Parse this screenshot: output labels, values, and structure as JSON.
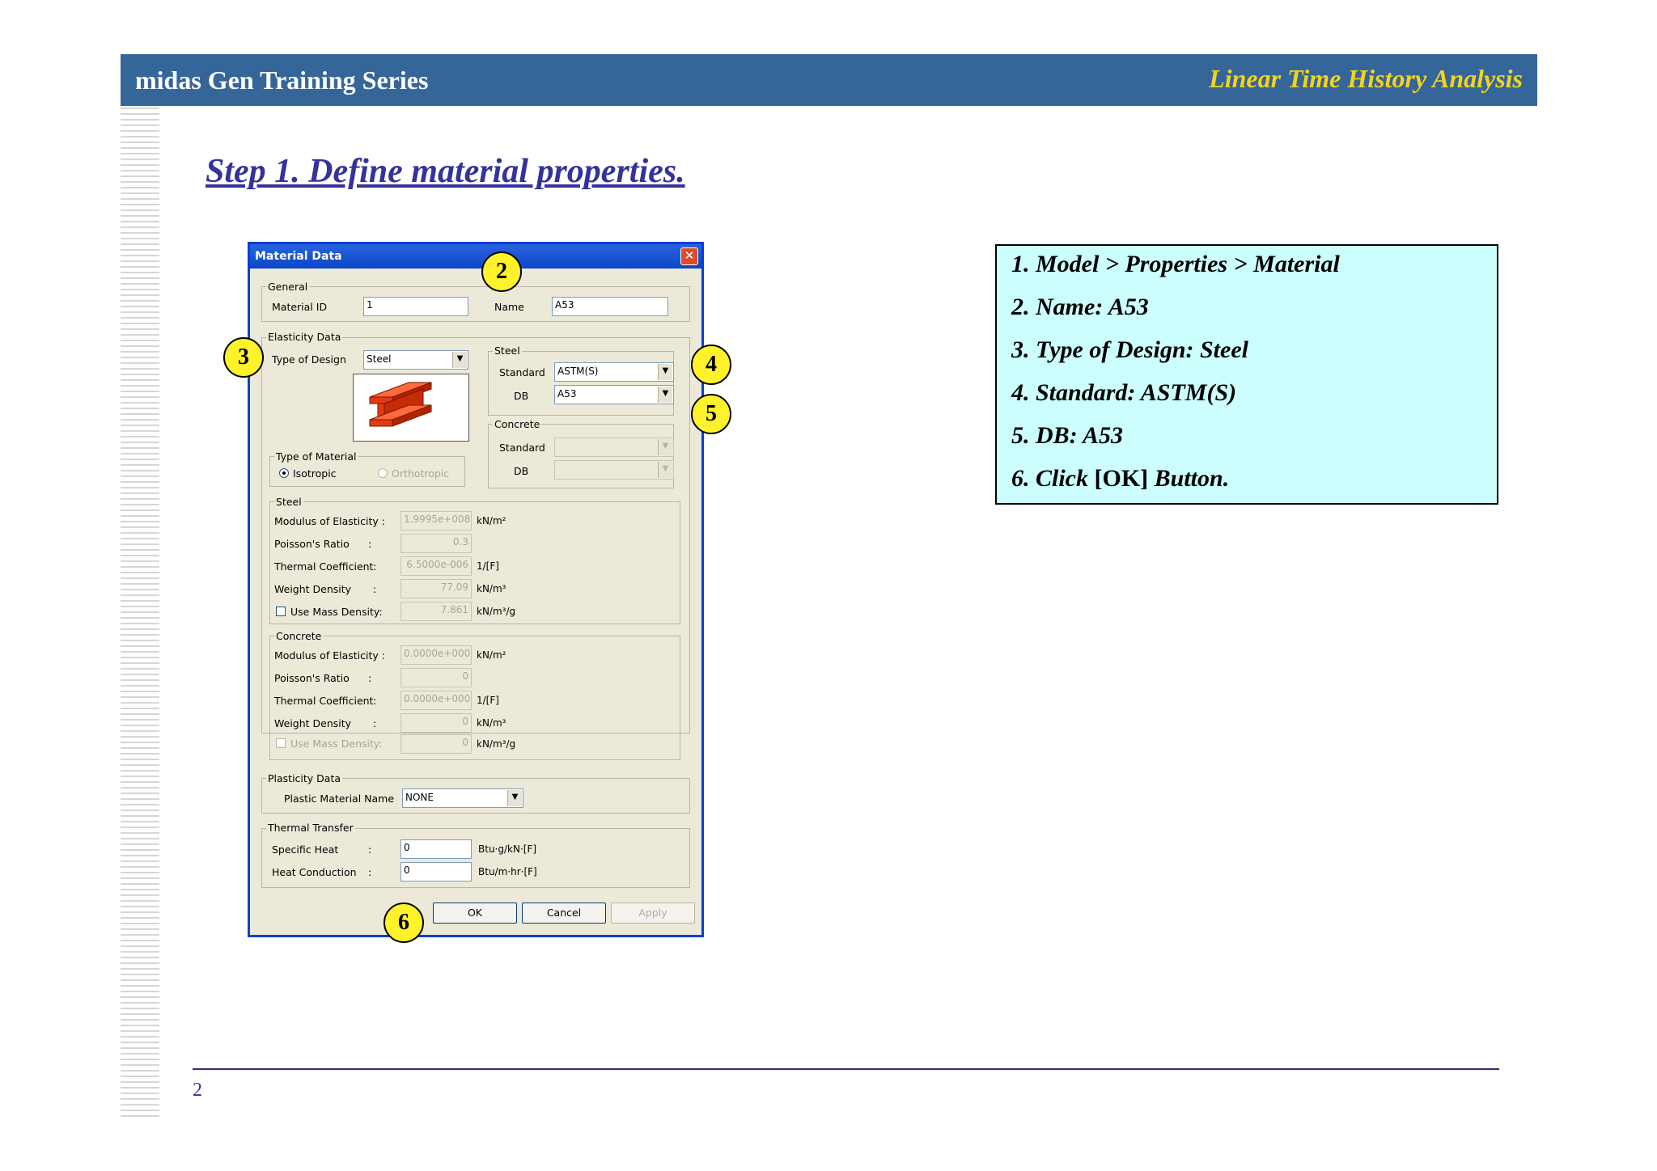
{
  "header": {
    "left_title": "midas Gen Training Series",
    "right_title": "Linear Time History Analysis"
  },
  "step_title": "Step 1. Define material properties.",
  "page_number": "2",
  "dialog": {
    "title": "Material Data",
    "close_symbol": "✕",
    "general": {
      "label": "General",
      "material_id_label": "Material ID",
      "material_id_value": "1",
      "name_label": "Name",
      "name_value": "A53"
    },
    "elasticity": {
      "label": "Elasticity Data",
      "type_of_design_label": "Type of Design",
      "type_of_design_value": "Steel",
      "steel_group_label": "Steel",
      "standard_label": "Standard",
      "standard_value": "ASTM(S)",
      "db_label": "DB",
      "db_value": "A53",
      "concrete_group_label": "Concrete",
      "concrete_standard_label": "Standard",
      "concrete_db_label": "DB",
      "type_of_material_label": "Type of Material",
      "isotropic_label": "Isotropic",
      "orthotropic_label": "Orthotropic"
    },
    "steel": {
      "label": "Steel",
      "rows": [
        {
          "label": "Modulus of Elasticity :",
          "value": "1.9995e+008",
          "unit": "kN/m²"
        },
        {
          "label": "Poisson's Ratio",
          "colon": ":",
          "value": "0.3",
          "unit": ""
        },
        {
          "label": "Thermal Coefficient",
          "colon": ":",
          "value": "6.5000e-006",
          "unit": "1/[F]"
        },
        {
          "label": "Weight Density",
          "colon": ":",
          "value": "77.09",
          "unit": "kN/m³"
        },
        {
          "label": "Use Mass Density:",
          "value": "7.861",
          "unit": "kN/m³/g"
        }
      ]
    },
    "concrete": {
      "label": "Concrete",
      "rows": [
        {
          "label": "Modulus of Elasticity :",
          "value": "0.0000e+000",
          "unit": "kN/m²"
        },
        {
          "label": "Poisson's Ratio",
          "colon": ":",
          "value": "0",
          "unit": ""
        },
        {
          "label": "Thermal Coefficient",
          "colon": ":",
          "value": "0.0000e+000",
          "unit": "1/[F]"
        },
        {
          "label": "Weight Density",
          "colon": ":",
          "value": "0",
          "unit": "kN/m³"
        },
        {
          "label": "Use Mass Density:",
          "value": "0",
          "unit": "kN/m³/g"
        }
      ]
    },
    "plasticity": {
      "label": "Plasticity Data",
      "name_label": "Plastic Material Name",
      "name_value": "NONE"
    },
    "thermal": {
      "label": "Thermal Transfer",
      "specific_heat_label": "Specific Heat",
      "specific_heat_value": "0",
      "specific_heat_unit": "Btu·g/kN·[F]",
      "heat_conduction_label": "Heat Conduction",
      "heat_conduction_value": "0",
      "heat_conduction_unit": "Btu/m·hr·[F]",
      "colon": ":"
    },
    "buttons": {
      "ok": "OK",
      "cancel": "Cancel",
      "apply": "Apply"
    }
  },
  "callouts": [
    "2",
    "3",
    "4",
    "5",
    "6"
  ],
  "instructions": {
    "line1": "1. Model > Properties > Material",
    "line2": "2. Name: A53",
    "line3": "3. Type of Design: Steel",
    "line4": "4. Standard: ASTM(S)",
    "line5": "5. DB: A53",
    "line6_pre": "6. Click ",
    "line6_ok": "[OK]",
    "line6_post": " Button."
  },
  "colors": {
    "header_bg": "#35669a",
    "header_right_text": "#f4d31d",
    "step_title": "#33339a",
    "callout": "#fff22a",
    "instructions_bg": "#ccfefe"
  }
}
